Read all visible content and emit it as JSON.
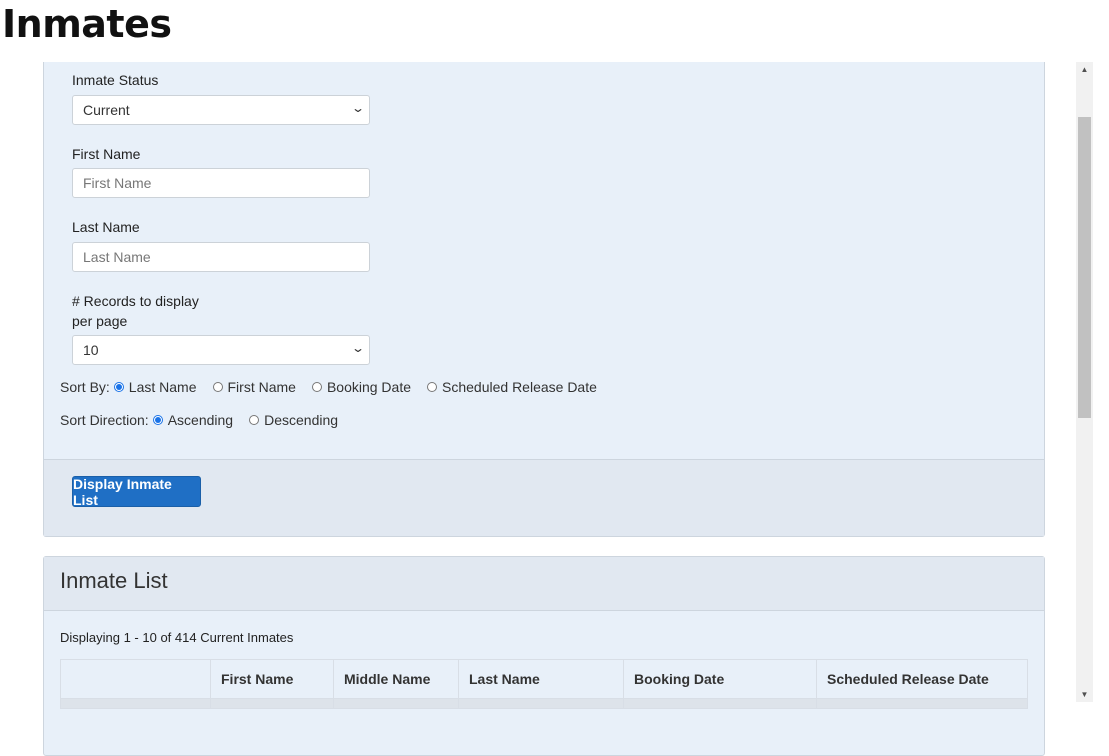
{
  "page_title": "Inmates",
  "search": {
    "status_label": "Inmate Status",
    "status_value": "Current",
    "first_label": "First Name",
    "first_placeholder": "First Name",
    "last_label": "Last Name",
    "last_placeholder": "Last Name",
    "records_label_1": "# Records to display",
    "records_label_2": "per page",
    "records_value": "10",
    "sort_by_label": "Sort By:",
    "sort_by_options": [
      "Last Name",
      "First Name",
      "Booking Date",
      "Scheduled Release Date"
    ],
    "sort_dir_label": "Sort Direction:",
    "sort_dir_options": [
      "Ascending",
      "Descending"
    ],
    "submit": "Display Inmate List"
  },
  "list": {
    "title": "Inmate List",
    "summary": "Displaying 1 - 10 of 414 Current Inmates",
    "columns": [
      "",
      "First Name",
      "Middle Name",
      "Last Name",
      "Booking Date",
      "Scheduled Release Date"
    ]
  }
}
